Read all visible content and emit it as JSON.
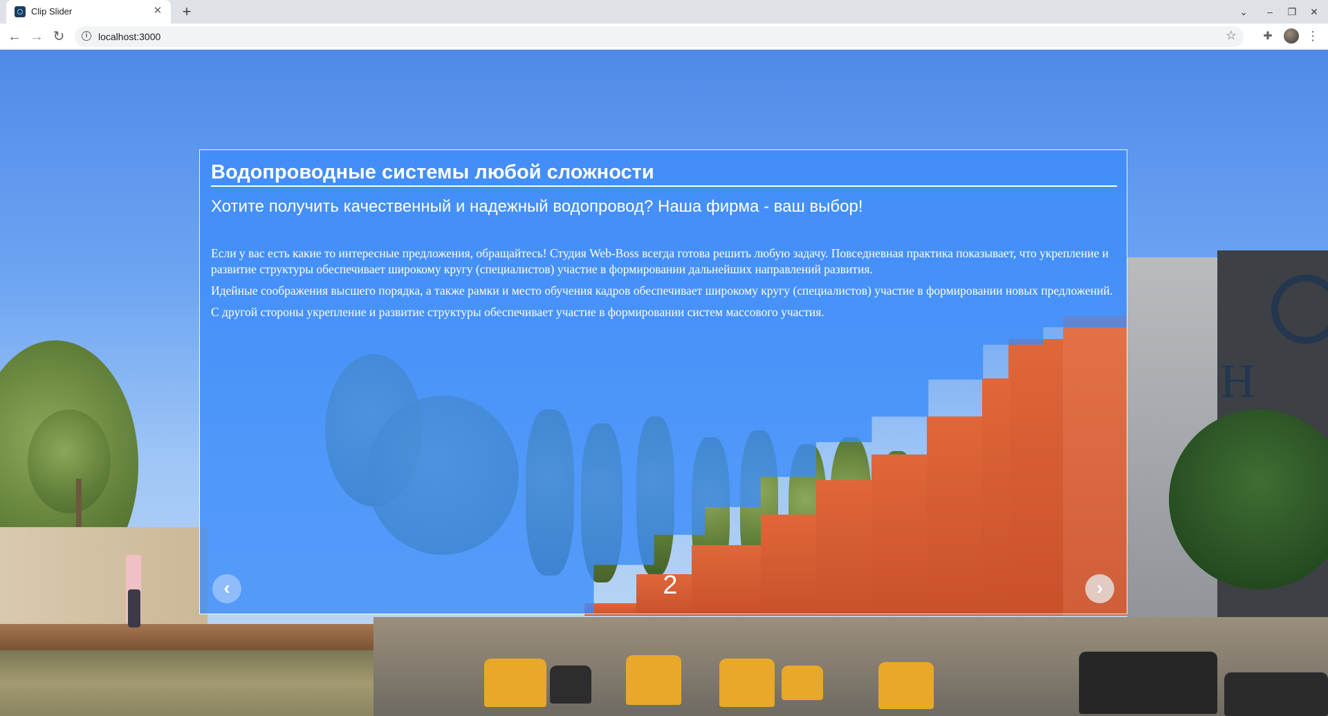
{
  "browser": {
    "tab_title": "Clip Slider",
    "tab_close": "✕",
    "new_tab": "+",
    "url": "localhost:3000",
    "window_controls": [
      "⌄",
      "–",
      "❐",
      "✕"
    ]
  },
  "slider": {
    "heading": "Водопроводные системы любой сложности",
    "subheading": "Хотите получить качественный и надежный водопровод? Наша фирма - ваш выбор!",
    "paragraphs": [
      "Если у вас есть какие то интересные предложения, обращайтесь! Студия Web-Boss всегда готова решить любую задачу. Повседневная практика показывает, что укрепление и развитие структуры обеспечивает широкому кругу (специалистов) участие в формировании дальнейших направлений развития.",
      "Идейные соображения высшего порядка, а также рамки и место обучения кадров обеспечивает широкому кругу (специалистов) участие в формировании новых предложений.",
      "С другой стороны укрепление и развитие структуры обеспечивает участие в формировании систем массового участия."
    ],
    "current_slide": "2",
    "prev_arrow": "‹",
    "next_arrow": "›"
  },
  "colors": {
    "overlay_blue": "#3c8cfa",
    "clip_orange": "#d85a30"
  },
  "icons": {
    "tab_favicon": "react-icon",
    "info": "info-icon",
    "bookmark": "star-icon",
    "extensions": "puzzle-icon",
    "menu": "kebab-menu-icon"
  }
}
